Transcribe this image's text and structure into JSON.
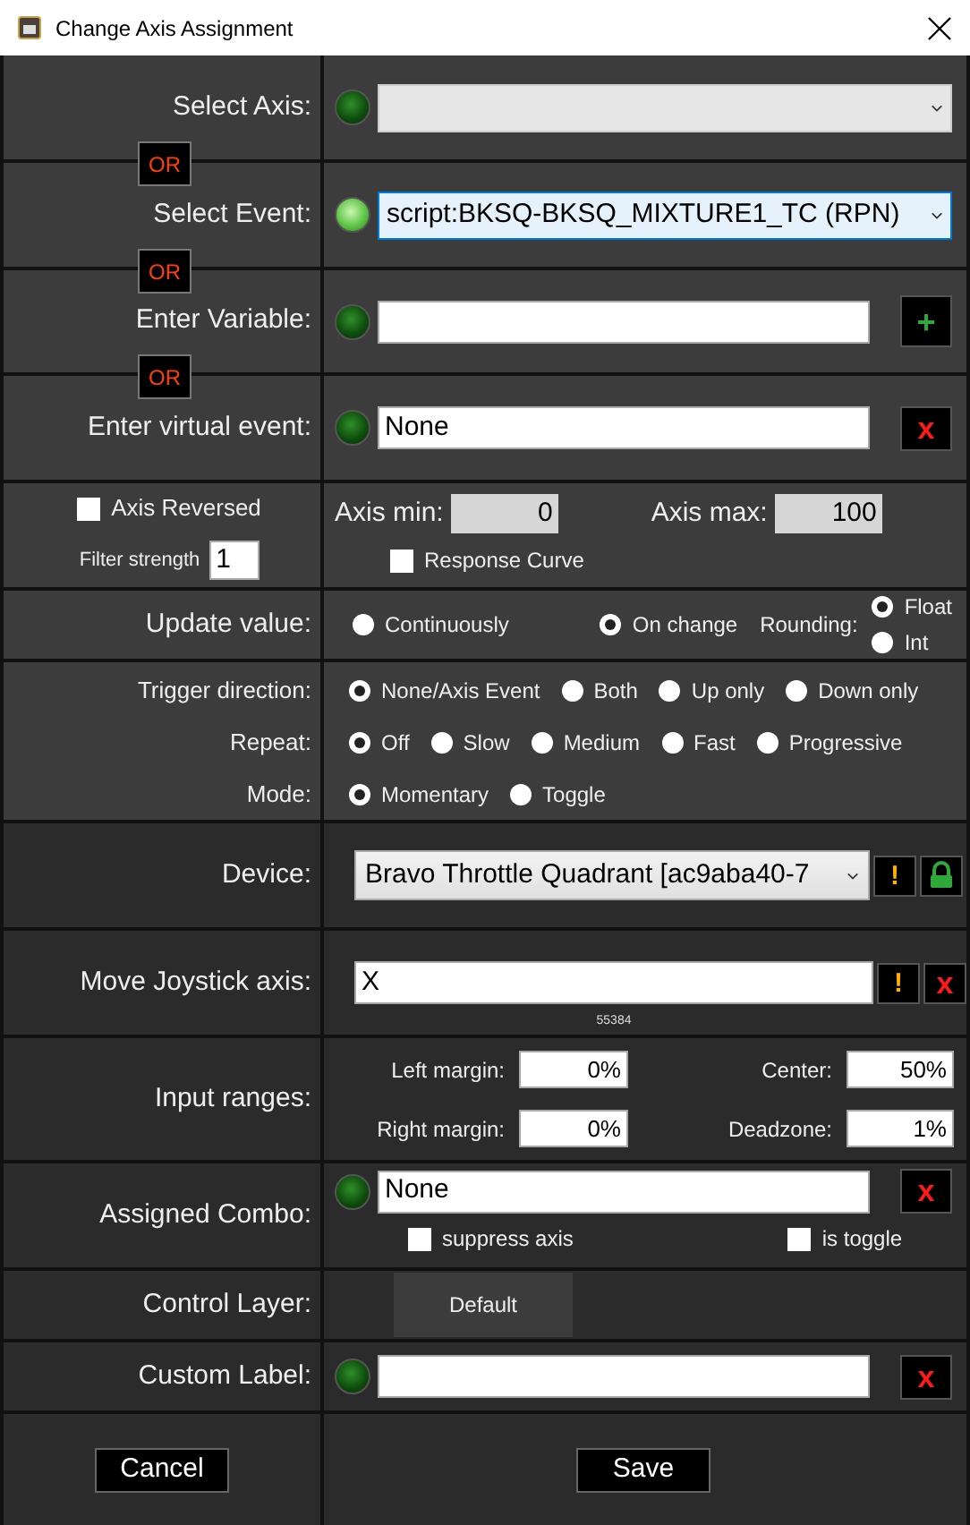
{
  "window": {
    "title": "Change Axis Assignment"
  },
  "sources": [
    {
      "label": "Select Axis:",
      "kind": "dropdown",
      "led_on": false,
      "focused": false
    },
    {
      "label": "Select Event:",
      "kind": "dropdown",
      "led_on": true,
      "focused": true,
      "value": "script:BKSQ-BKSQ_MIXTURE1_TC (RPN)",
      "separator": "OR"
    },
    {
      "label": "Enter Variable:",
      "kind": "field",
      "led_on": false,
      "separator": "OR",
      "button": {
        "text": "+",
        "kind": "add"
      }
    },
    {
      "label": "Enter virtual event:",
      "kind": "field",
      "led_on": false,
      "value": "None",
      "separator": "OR",
      "button": {
        "text": "x",
        "kind": "clear"
      }
    }
  ],
  "axis_options": {
    "reversed": {
      "label": "Axis Reversed",
      "checked": false
    },
    "filter": {
      "label": "Filter strength",
      "value": "1"
    },
    "min": {
      "label": "Axis min:",
      "value": "0"
    },
    "max": {
      "label": "Axis max:",
      "value": "100"
    },
    "response_curve": {
      "label": "Response Curve",
      "checked": false
    }
  },
  "update_value": {
    "label": "Update value:",
    "options": [
      {
        "label": "Continuously",
        "selected": false
      },
      {
        "label": "On change",
        "selected": true
      }
    ],
    "rounding": {
      "label": "Rounding:",
      "options": [
        {
          "label": "Float",
          "selected": true
        },
        {
          "label": "Int",
          "selected": false
        }
      ]
    }
  },
  "triggers": [
    {
      "label": "Trigger direction:",
      "options": [
        {
          "label": "None/Axis Event",
          "selected": true
        },
        {
          "label": "Both",
          "selected": false
        },
        {
          "label": "Up only",
          "selected": false
        },
        {
          "label": "Down only",
          "selected": false
        }
      ]
    },
    {
      "label": "Repeat:",
      "options": [
        {
          "label": "Off",
          "selected": true
        },
        {
          "label": "Slow",
          "selected": false
        },
        {
          "label": "Medium",
          "selected": false
        },
        {
          "label": "Fast",
          "selected": false
        },
        {
          "label": "Progressive",
          "selected": false
        }
      ]
    },
    {
      "label": "Mode:",
      "options": [
        {
          "label": "Momentary",
          "selected": true
        },
        {
          "label": "Toggle",
          "selected": false
        }
      ]
    }
  ],
  "device": {
    "label": "Device:",
    "value": "Bravo Throttle Quadrant [ac9aba40-7",
    "buttons": [
      {
        "text": "!",
        "kind": "warning"
      },
      {
        "kind": "lock"
      }
    ]
  },
  "joystick": {
    "label": "Move Joystick axis:",
    "value": "X",
    "reading": "55384",
    "buttons": [
      {
        "text": "!",
        "kind": "warning"
      },
      {
        "text": "x",
        "kind": "clear"
      }
    ]
  },
  "input_ranges": {
    "label": "Input ranges:",
    "fields": [
      {
        "label": "Left margin:",
        "value": "0%"
      },
      {
        "label": "Center:",
        "value": "50%"
      },
      {
        "label": "Right margin:",
        "value": "0%"
      },
      {
        "label": "Deadzone:",
        "value": "1%"
      }
    ]
  },
  "combo": {
    "label": "Assigned Combo:",
    "led_on": false,
    "value": "None",
    "button": {
      "text": "x",
      "kind": "clear"
    },
    "options": [
      {
        "label": "suppress axis",
        "checked": false
      },
      {
        "label": "is toggle",
        "checked": false
      }
    ]
  },
  "control_layer": {
    "label": "Control Layer:",
    "button": "Default"
  },
  "custom_label": {
    "label": "Custom Label:",
    "led_on": false,
    "button": {
      "text": "x",
      "kind": "clear"
    }
  },
  "footer": {
    "cancel": "Cancel",
    "save": "Save"
  }
}
